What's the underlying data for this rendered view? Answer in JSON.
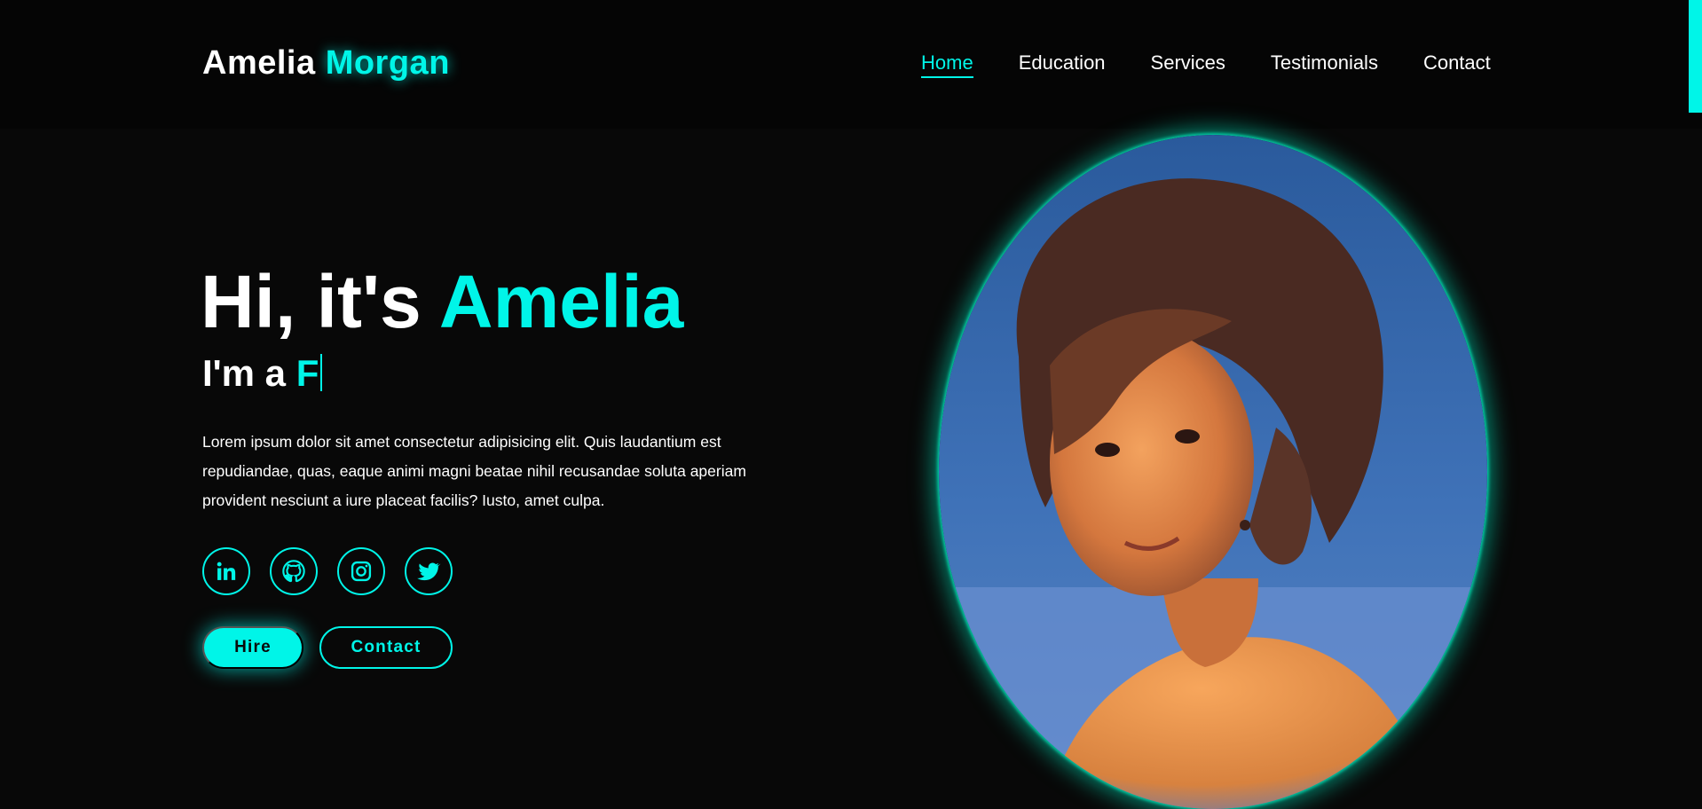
{
  "header": {
    "logo": {
      "first": "Amelia",
      "last": "Morgan"
    },
    "nav": [
      {
        "label": "Home",
        "active": true
      },
      {
        "label": "Education",
        "active": false
      },
      {
        "label": "Services",
        "active": false
      },
      {
        "label": "Testimonials",
        "active": false
      },
      {
        "label": "Contact",
        "active": false
      }
    ]
  },
  "hero": {
    "greeting": "Hi, it's",
    "name": "Amelia",
    "subtitle_prefix": "I'm a",
    "typed_text": "F",
    "description": "Lorem ipsum dolor sit amet consectetur adipisicing elit. Quis laudantium est repudiandae, quas, eaque animi magni beatae nihil recusandae soluta aperiam provident nesciunt a iure placeat facilis? Iusto, amet culpa.",
    "socials": [
      {
        "icon": "linkedin-icon"
      },
      {
        "icon": "github-icon"
      },
      {
        "icon": "instagram-icon"
      },
      {
        "icon": "twitter-icon"
      }
    ],
    "buttons": {
      "hire": "Hire",
      "contact": "Contact"
    },
    "portrait": {
      "icon": "profile-photo"
    }
  },
  "colors": {
    "accent": "#00f5e8",
    "background": "#080808",
    "header_background": "#050505",
    "portrait_glow": "#00e6be"
  }
}
